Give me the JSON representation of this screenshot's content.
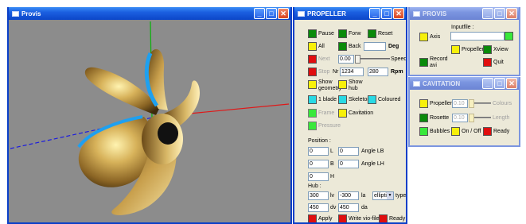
{
  "provis_window": {
    "title": "Provis",
    "active": true
  },
  "propeller_window": {
    "title": "PROPELLER",
    "controls": {
      "pause": "Pause",
      "forw": "Forw",
      "reset": "Reset",
      "all": "All",
      "back": "Back",
      "deg_value": "",
      "deg_unit": "Deg",
      "next": "Next",
      "speed_value": "0.00",
      "speed_label": "Speed",
      "stop": "Stop",
      "nr_label": "Nr",
      "nr_value": "1234",
      "rpm_value": "280",
      "rpm_unit": "Rpm",
      "show_geometry": "Show geometry",
      "show_hub": "Show hub",
      "one_blade": "1 blade",
      "skeleton": "Skeleton",
      "coloured": "Coloured",
      "frame": "Frame",
      "cavitation": "Cavitation",
      "pressure": "Pressure"
    },
    "position": {
      "title": "Position :",
      "l_value": "0",
      "l_label": "L",
      "angle_lb_value": "0",
      "angle_lb_label": "Angle LB",
      "b_value": "0",
      "b_label": "B",
      "angle_lh_value": "0",
      "angle_lh_label": "Angle LH",
      "h_value": "0",
      "h_label": "H"
    },
    "hub": {
      "title": "Hub :",
      "lv_value": "300",
      "lv_label": "lv",
      "la_value": "-300",
      "la_label": "la",
      "type_selected": "ellipti",
      "type_label": "type",
      "dv_value": "450",
      "dv_label": "dv",
      "da_value": "450",
      "da_label": "da"
    },
    "footer": {
      "apply": "Apply",
      "write_vio": "Write vio-file",
      "ready": "Ready"
    }
  },
  "provis_small_window": {
    "title": "PROVIS",
    "inputfile_label": "Inputfile :",
    "inputfile_value": "",
    "axis": "Axis",
    "propeller": "Propeller",
    "xview": "Xview",
    "record_avi": "Record avi",
    "quit": "Quit"
  },
  "cavitation_window": {
    "title": "CAVITATION",
    "propeller": "Propeller",
    "propeller_value": "0.10",
    "colours": "Colours",
    "rosette": "Rosette",
    "rosette_value": "0.10",
    "length": "Length",
    "bubbles": "Bubbles",
    "on_off": "On / Off",
    "ready": "Ready"
  },
  "colors": {
    "title_active": "#0c46c8",
    "title_inactive": "#7b95e0",
    "panel": "#ece9d8",
    "viewport": "#8c8c8c",
    "blade_gold": "#b48a38",
    "blade_edge": "#1ea0f0"
  }
}
